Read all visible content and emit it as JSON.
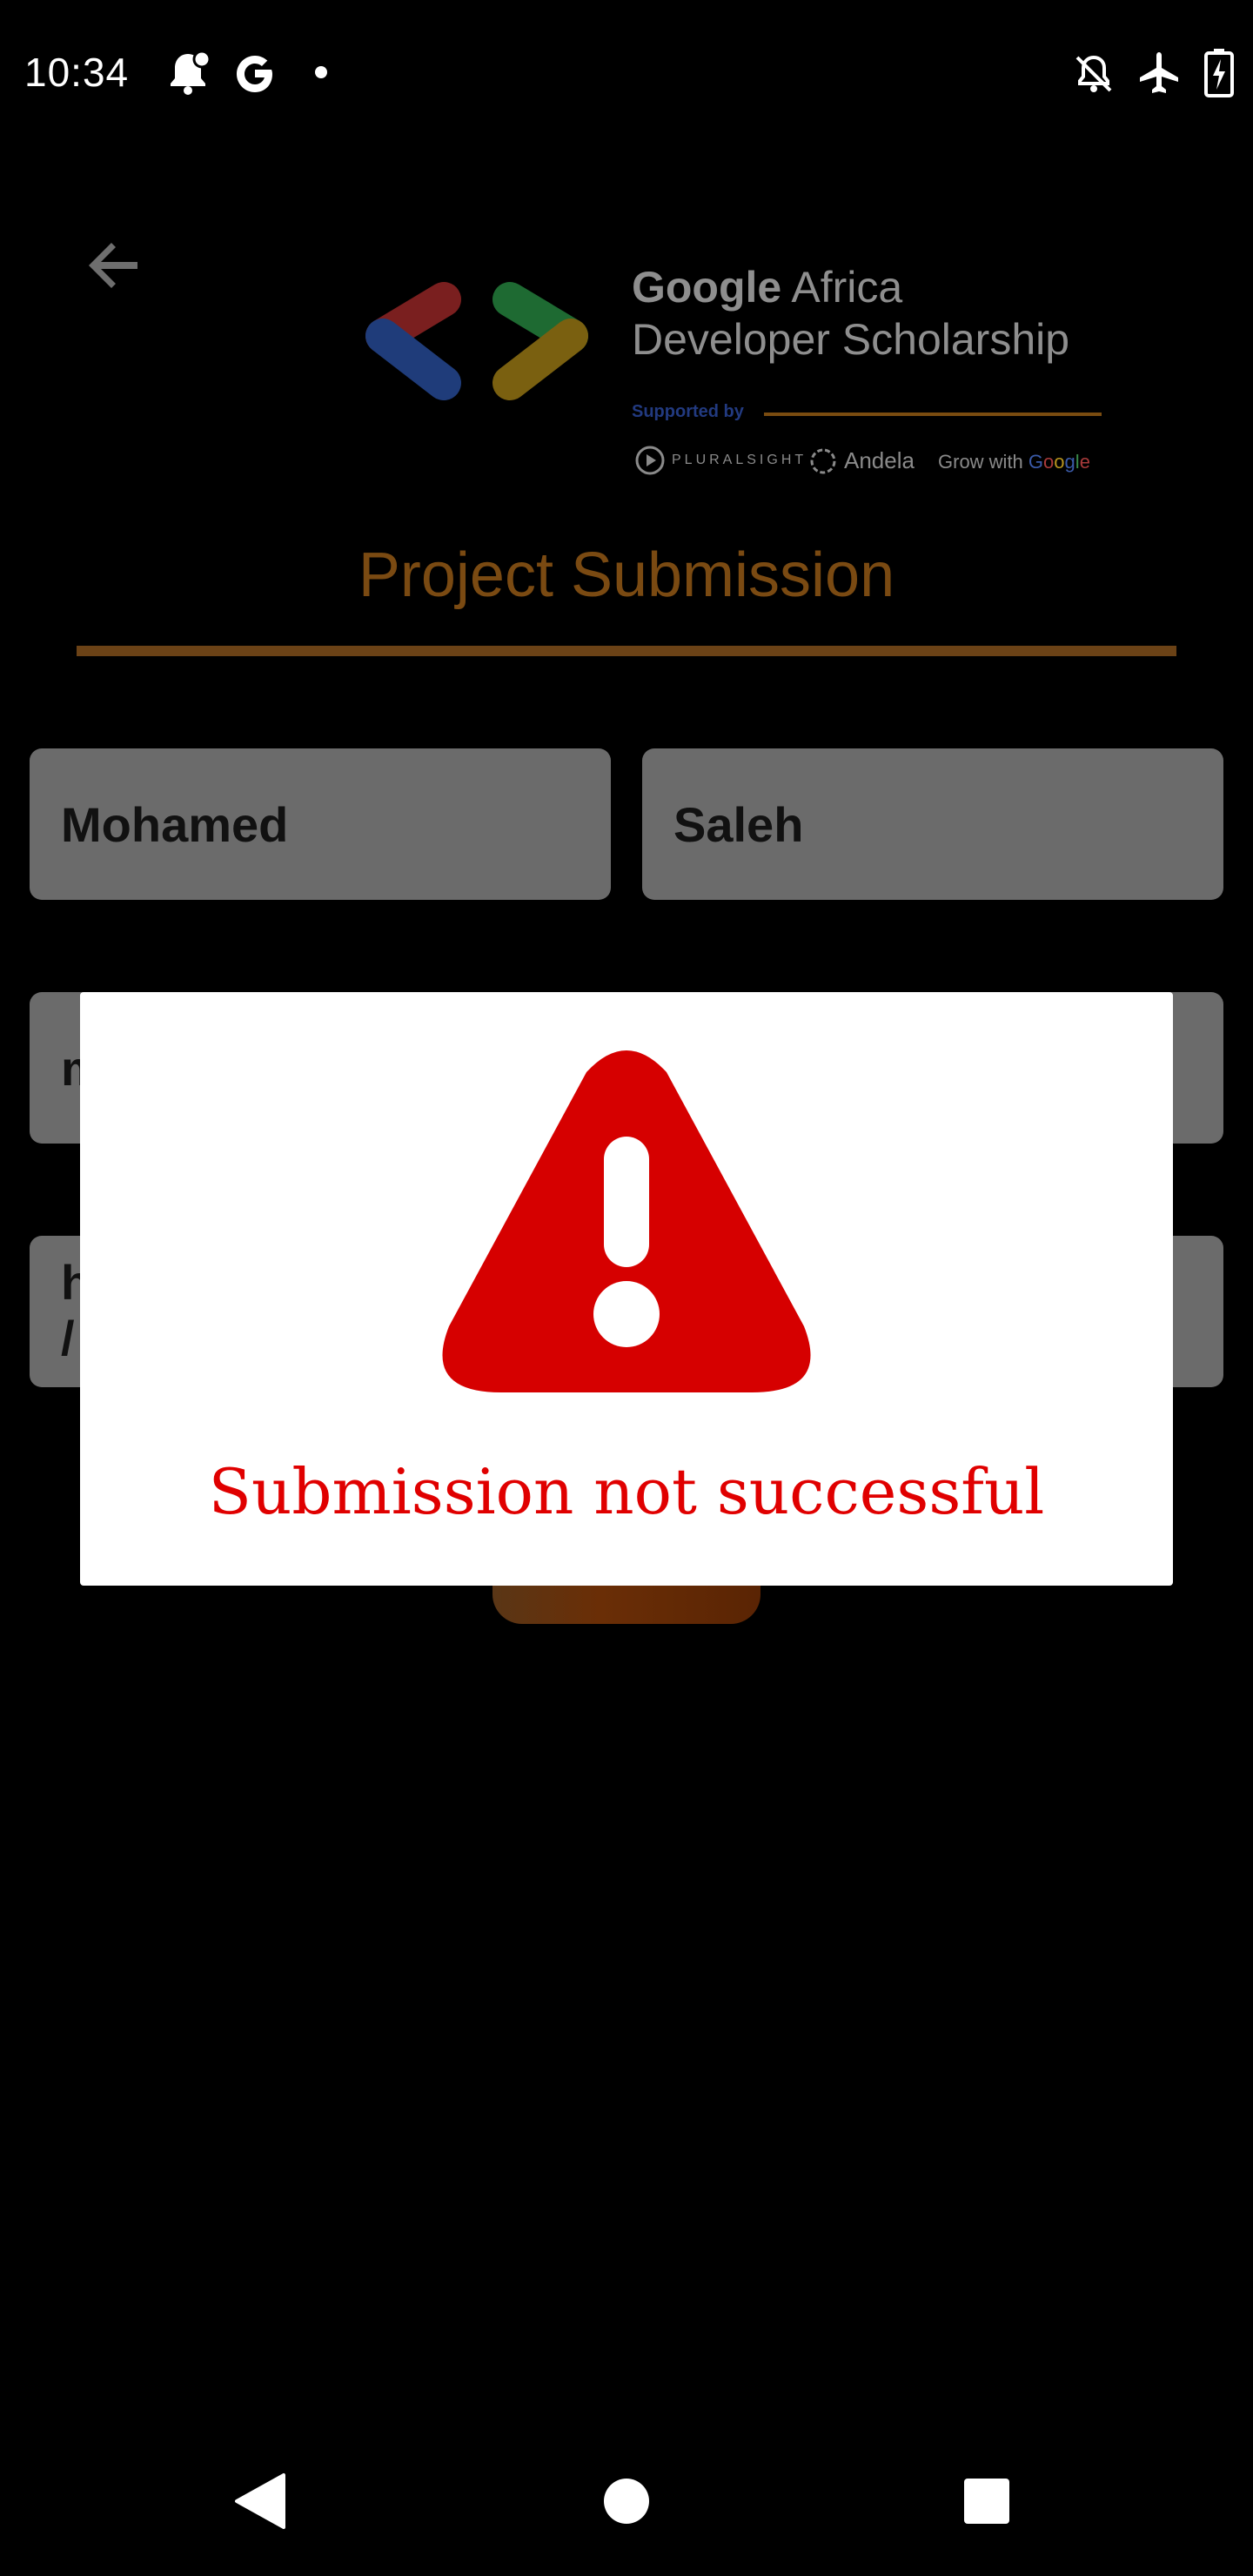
{
  "status_bar": {
    "time": "10:34",
    "icons": [
      "notification-bell-icon",
      "google-g-icon",
      "dot-icon",
      "do-not-disturb-off-icon",
      "airplane-mode-icon",
      "battery-charging-icon"
    ]
  },
  "header": {
    "back_icon": "arrow-back-icon",
    "logo_line1_bold": "Google",
    "logo_line1_rest": " Africa",
    "logo_line2": "Developer Scholarship",
    "supported_by": "Supported by",
    "partners": {
      "pluralsight": "PLURALSIGHT",
      "andela": "Andela",
      "grow_prefix": "Grow with ",
      "grow_google": [
        "G",
        "o",
        "o",
        "g",
        "l",
        "e"
      ]
    }
  },
  "page": {
    "title": "Project Submission"
  },
  "form": {
    "first_name": "Mohamed",
    "last_name": "Saleh",
    "email_visible": "m",
    "link_visible_line1": "h",
    "link_visible_line2": "/"
  },
  "dialog": {
    "icon": "warning-triangle-icon",
    "message": "Submission not successful"
  },
  "colors": {
    "accent": "#7a4a12",
    "error": "#e00000",
    "dialog_bg": "#ffffff",
    "field_bg": "#6b6b6b"
  },
  "nav_bar": {
    "icons": [
      "nav-back-icon",
      "nav-home-icon",
      "nav-recents-icon"
    ]
  }
}
